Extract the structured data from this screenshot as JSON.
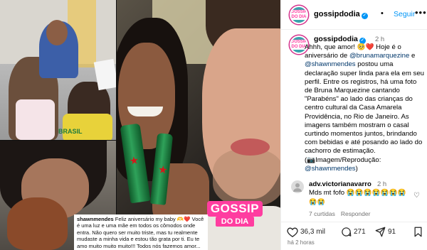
{
  "header": {
    "username": "gossipdodia",
    "follow_label": "Seguir",
    "follow_dot": "•",
    "more_icon": "more-horizontal-icon",
    "avatar_text": "GOSSIP DO DIA"
  },
  "post": {
    "username": "gossipdodia",
    "time": "2 h",
    "text_intro": "Ahhh, que amor! 🥺❤️ Hoje é o aniversário de ",
    "mention1": "@brunamarquezine",
    "text_e": " e ",
    "mention2": "@shawnmendes",
    "text_body": " postou uma declaração super linda para ela em seu perfil. Entre os registros, há uma foto de Bruna Marquezine cantando \"Parabéns\" ao lado das crianças do centro cultural da Casa Amarela Providência, no Rio de Janeiro. As imagens também mostram o casal curtindo momentos juntos, brindando com bebidas e até posando ao lado do cachorro de estimação.",
    "credit_label": "(📷Imagem/Reprodução: ",
    "credit_mention": "@shawnmendes",
    "credit_end": ")"
  },
  "comment": {
    "username": "adv.victorianavarro",
    "time": "2 h",
    "text": "Mds mt fofo 😭😭😭😭😭😭😭",
    "emojis": "😭😭",
    "likes_label": "7 curtidas",
    "reply_label": "Responder"
  },
  "actions": {
    "like_count": "36,3 mil",
    "comment_count": "271",
    "share_count": "91",
    "time_ago": "há 2 horas"
  },
  "media": {
    "watermark_top": "GOSSIP",
    "watermark_bottom": "DO DIA",
    "bottle_brand": "Heineken",
    "shirt_text": "BRASIL",
    "caption_username": "shawnmendes",
    "caption_text": " Feliz aniversário my baby 🫶❤️ Você é uma luz e uma mãe em todos os cômodos onde entra. Não quero ser muito triste, mas tu realmente mudaste a minha vida e estou tão grata por ti. Eu te amo muito muito muito!!! Todos nós fazemos amor... &"
  },
  "colors": {
    "accent": "#0095f6",
    "brand_pink": "#ff3da0",
    "mention": "#00376b",
    "muted": "#737373"
  }
}
